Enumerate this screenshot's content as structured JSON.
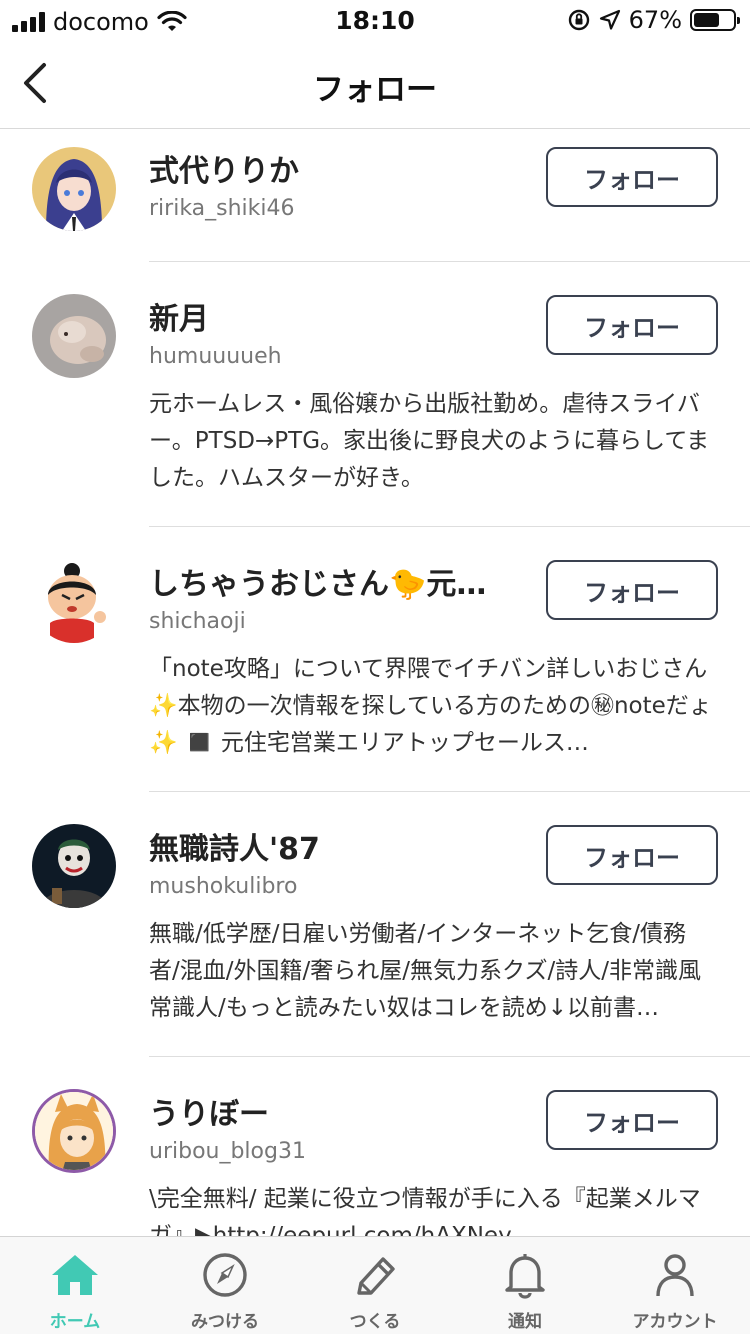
{
  "status_bar": {
    "carrier": "docomo",
    "time": "18:10",
    "battery_percent": "67%",
    "battery_level": 0.67
  },
  "header": {
    "title": "フォロー"
  },
  "users": [
    {
      "name": "式代りりか",
      "handle": "ririka_shiki46",
      "bio": "",
      "follow_label": "フォロー"
    },
    {
      "name": "新月",
      "handle": "humuuuueh",
      "bio": "元ホームレス・風俗嬢から出版社勤め。虐待スライバー。PTSD→PTG。家出後に野良犬のように暮らしてました。ハムスターが好き。",
      "follow_label": "フォロー"
    },
    {
      "name": "しちゃうおじさん🐤元…",
      "handle": "shichaoji",
      "bio": "「note攻略」について界隈でイチバン詳しいおじさん✨本物の一次情報を探している方のための㊙noteだょ✨ ◼️ 元住宅営業エリアトップセールス…",
      "follow_label": "フォロー"
    },
    {
      "name": "無職詩人'87",
      "handle": "mushokulibro",
      "bio": "無職/低学歴/日雇い労働者/インターネット乞食/債務者/混血/外国籍/奢られ屋/無気力系クズ/詩人/非常識風常識人/もっと読みたい奴はコレを読め↓以前書…",
      "follow_label": "フォロー"
    },
    {
      "name": "うりぼー",
      "handle": "uribou_blog31",
      "bio": "\\完全無料/ 起業に役立つ情報が手に入る『起業メルマガ』▶http://eepurl.com/hAXNey",
      "follow_label": "フォロー"
    }
  ],
  "tab_bar": {
    "tabs": [
      {
        "label": "ホーム",
        "icon": "home-icon",
        "active": true
      },
      {
        "label": "みつける",
        "icon": "compass-icon",
        "active": false
      },
      {
        "label": "つくる",
        "icon": "pencil-icon",
        "active": false
      },
      {
        "label": "通知",
        "icon": "bell-icon",
        "active": false
      },
      {
        "label": "アカウント",
        "icon": "person-icon",
        "active": false
      }
    ],
    "active_color": "#41c9b4",
    "inactive_color": "#666666"
  }
}
